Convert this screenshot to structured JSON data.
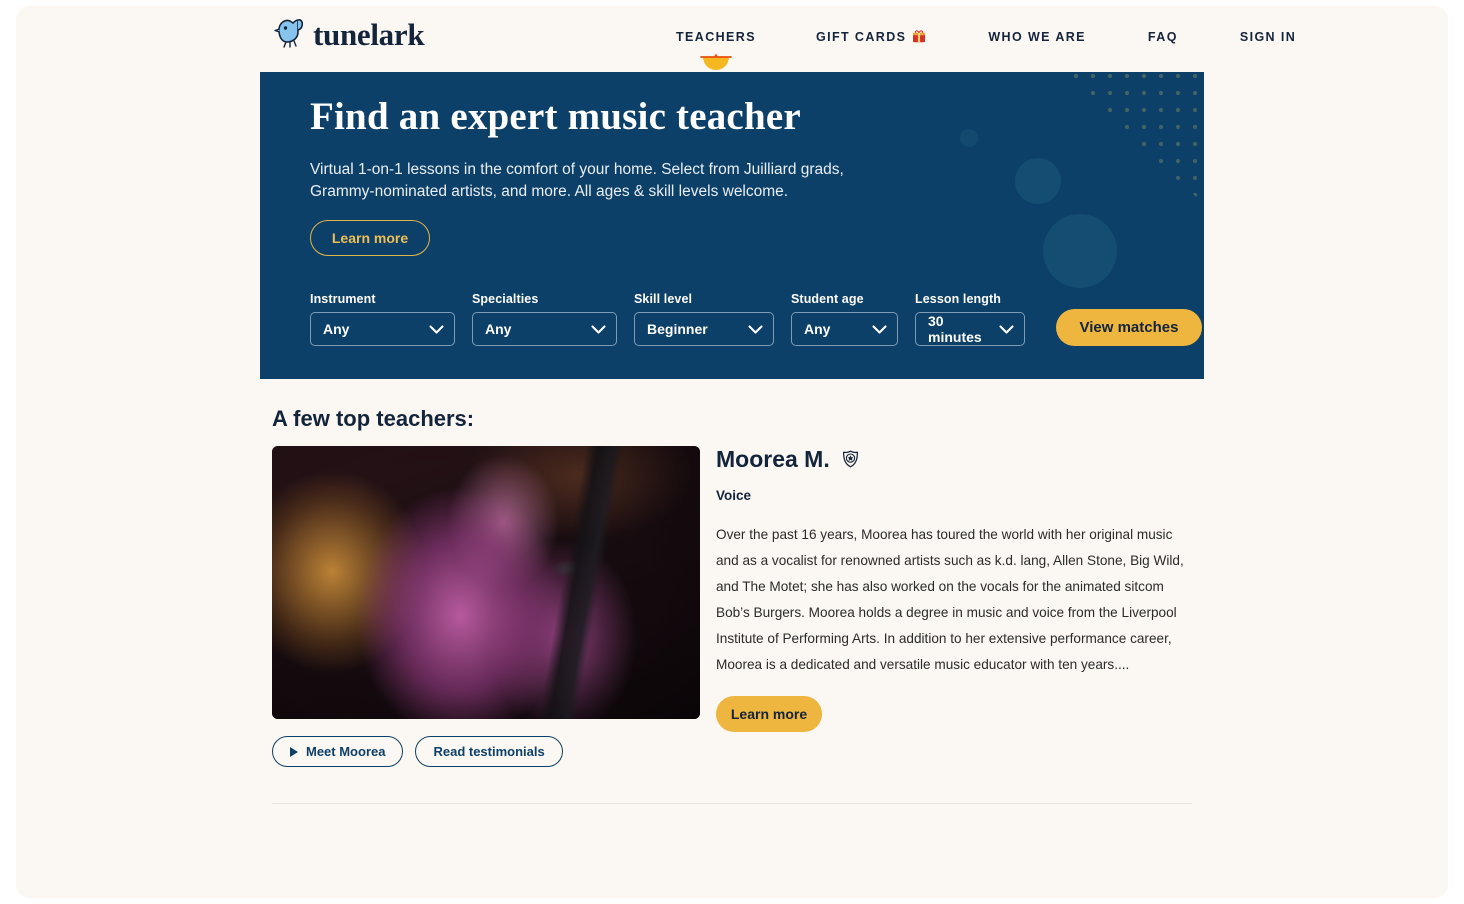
{
  "brand": {
    "name": "tunelark",
    "logo_icon": "bird-music-note-logo",
    "logo_color": "#6fb7e8"
  },
  "nav": {
    "items": [
      {
        "label": "TEACHERS",
        "active": true,
        "icon": null
      },
      {
        "label": "GIFT CARDS",
        "active": false,
        "icon": "gift-box-icon"
      },
      {
        "label": "WHO WE ARE",
        "active": false,
        "icon": null
      },
      {
        "label": "FAQ",
        "active": false,
        "icon": null
      },
      {
        "label": "SIGN IN",
        "active": false,
        "icon": null
      }
    ],
    "active_underline_color": "#f5b820"
  },
  "hero": {
    "background_color": "#0d4068",
    "title": "Find an expert music teacher",
    "subtitle": "Virtual 1-on-1 lessons in the comfort of your home. Select from Juilliard grads, Grammy-nominated artists, and more. All ages & skill levels welcome.",
    "learn_more_label": "Learn more",
    "learn_more_color": "#edbe55"
  },
  "filters": {
    "fields": [
      {
        "label": "Instrument",
        "value": "Any"
      },
      {
        "label": "Specialties",
        "value": "Any"
      },
      {
        "label": "Skill level",
        "value": "Beginner"
      },
      {
        "label": "Student age",
        "value": "Any"
      },
      {
        "label": "Lesson length",
        "value": "30 minutes"
      }
    ],
    "submit_label": "View matches",
    "submit_color": "#eeb53f"
  },
  "section": {
    "title": "A few top teachers:"
  },
  "teacher": {
    "name": "Moorea M.",
    "badge_icon": "verified-badge-icon",
    "subject": "Voice",
    "photo_alt": "Moorea singing into a microphone on stage",
    "bio": "Over the past 16 years, Moorea has toured the world with her original music and as a vocalist for renowned artists such as k.d. lang, Allen Stone, Big Wild, and The Motet; she has also worked on the vocals for the animated sitcom Bob’s Burgers. Moorea holds a degree in music and voice from the Liverpool Institute of Performing Arts. In addition to her extensive performance career, Moorea is a dedicated and versatile music educator with ten years....",
    "learn_more_label": "Learn more",
    "actions": [
      {
        "label": "Meet Moorea",
        "icon": "play-icon"
      },
      {
        "label": "Read testimonials",
        "icon": null
      }
    ]
  }
}
